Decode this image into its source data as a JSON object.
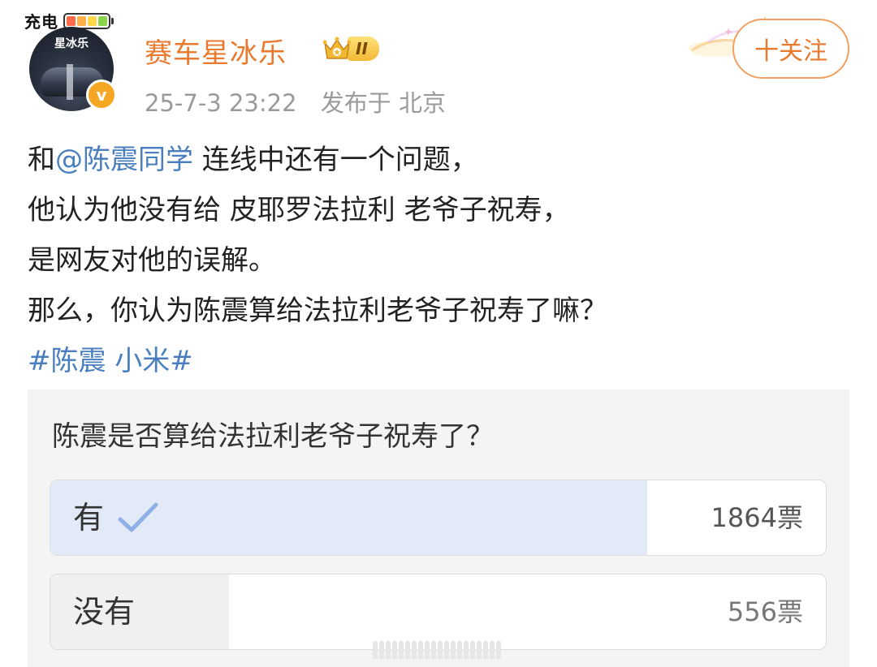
{
  "status": {
    "charge_label": "充电"
  },
  "user": {
    "name": "赛车星冰乐",
    "avatar_text": "星冰乐",
    "level_badge": "II",
    "verified_mark": "v",
    "timestamp": "25-7-3 23:22",
    "location": "发布于 北京",
    "follow_label": "十关注"
  },
  "post": {
    "line1_prefix": "和",
    "mention": "@陈震同学",
    "line1_suffix": " 连线中还有一个问题，",
    "line2": "他认为他没有给 皮耶罗法拉利 老爷子祝寿，",
    "line3": "是网友对他的误解。",
    "line4": "那么，你认为陈震算给法拉利老爷子祝寿了嘛？",
    "hashtag": "#陈震 小米#"
  },
  "poll": {
    "question": "陈震是否算给法拉利老爷子祝寿了？",
    "options": [
      {
        "label": "有",
        "votes": "1864票",
        "share": 0.77,
        "selected": true
      },
      {
        "label": "没有",
        "votes": "556票",
        "share": 0.23,
        "selected": false
      }
    ]
  },
  "colors": {
    "username": "#e8792d",
    "link": "#4a7fbf",
    "selected_fill": "#e2eaf7",
    "check": "#8fb0e6"
  },
  "icons": [
    "battery-icon",
    "crown-badge-icon",
    "verified-icon",
    "checkmark-icon",
    "sparkle-decoration"
  ]
}
